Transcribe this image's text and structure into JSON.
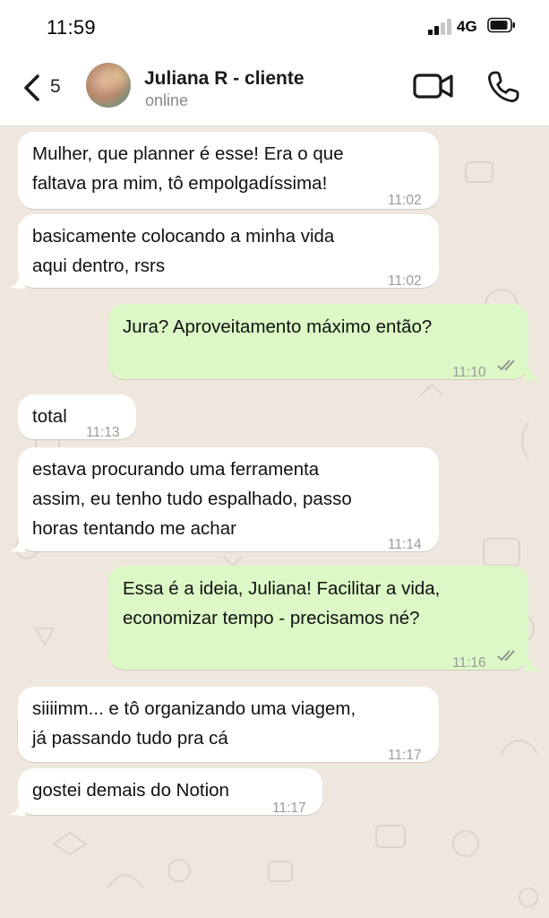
{
  "status_bar": {
    "time": "11:59",
    "network": "4G"
  },
  "header": {
    "back_count": "5",
    "contact_name": "Juliana R - cliente",
    "contact_status": "online"
  },
  "messages": [
    {
      "direction": "in",
      "text": "Mulher, que planner é esse! Era o que\nfaltava pra mim, tô empolgadíssima!",
      "time": "11:02"
    },
    {
      "direction": "in",
      "text": "basicamente colocando a minha vida\naqui dentro, rsrs",
      "time": "11:02"
    },
    {
      "direction": "out",
      "text": "Jura? Aproveitamento máximo então?",
      "time": "11:10",
      "read": true
    },
    {
      "direction": "in",
      "text": "total",
      "time": "11:13"
    },
    {
      "direction": "in",
      "text": "estava procurando uma ferramenta\nassim, eu tenho tudo espalhado, passo\nhoras tentando me achar",
      "time": "11:14"
    },
    {
      "direction": "out",
      "text": "Essa é a ideia, Juliana! Facilitar a vida,\neconomizar tempo - precisamos né?",
      "time": "11:16",
      "read": true
    },
    {
      "direction": "in",
      "text": "siiiimm... e tô organizando uma viagem,\njá passando tudo pra cá",
      "time": "11:17"
    },
    {
      "direction": "in",
      "text": "gostei demais do Notion",
      "time": "11:17"
    }
  ],
  "colors": {
    "incoming_bubble": "#ffffff",
    "outgoing_bubble": "#dcf8c6",
    "chat_background": "#efe7dd",
    "read_ticks": "#8a8a8a"
  }
}
